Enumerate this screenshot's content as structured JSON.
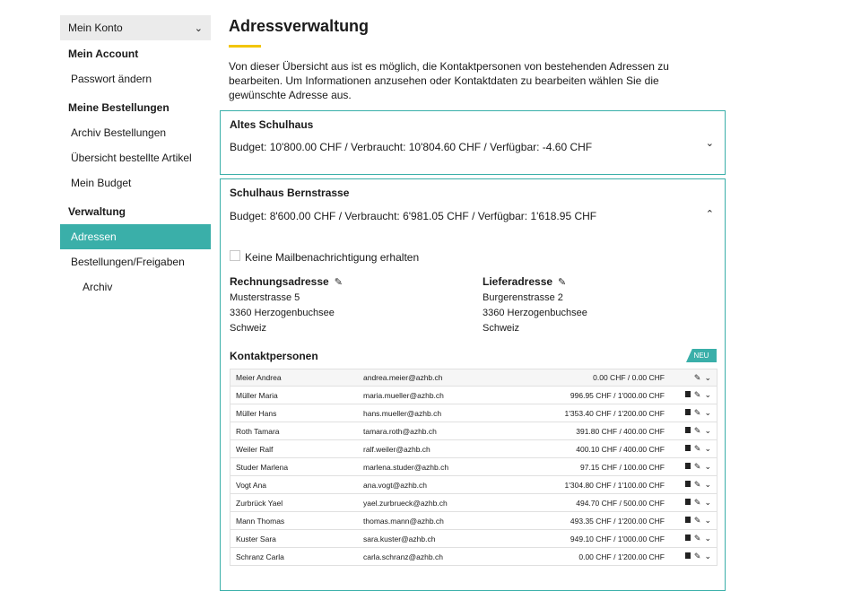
{
  "sidebar": {
    "header_label": "Mein Konto",
    "groups": [
      {
        "label": "Mein Account",
        "items": [
          {
            "label": "Passwort ändern"
          }
        ]
      },
      {
        "label": "Meine Bestellungen",
        "items": [
          {
            "label": "Archiv Bestellungen"
          },
          {
            "label": "Übersicht bestellte Artikel"
          },
          {
            "label": "Mein Budget"
          }
        ]
      },
      {
        "label": "Verwaltung",
        "items": [
          {
            "label": "Adressen"
          },
          {
            "label": "Bestellungen/Freigaben"
          },
          {
            "label": "Archiv"
          }
        ]
      }
    ]
  },
  "main": {
    "title": "Adressverwaltung",
    "intro": "Von dieser Übersicht aus ist es möglich, die Kontaktpersonen von bestehenden Adressen zu bearbeiten. Um Informationen anzusehen oder Kontaktdaten zu bearbeiten wählen Sie die gewünschte Adresse aus."
  },
  "cards": [
    {
      "title": "Altes Schulhaus",
      "budget": "Budget: 10'800.00 CHF / Verbraucht: 10'804.60 CHF / Verfügbar: -4.60 CHF"
    },
    {
      "title": "Schulhaus Bernstrasse",
      "budget": "Budget: 8'600.00 CHF / Verbraucht: 6'981.05 CHF / Verfügbar: 1'618.95 CHF"
    }
  ],
  "detail": {
    "checkbox_label": "Keine Mailbenachrichtigung erhalten",
    "rechnung": {
      "title": "Rechnungsadresse",
      "lines": [
        "Musterstrasse 5",
        "3360 Herzogenbuchsee",
        "Schweiz"
      ]
    },
    "liefer": {
      "title": "Lieferadresse",
      "lines": [
        "Burgerenstrasse 2",
        "3360 Herzogenbuchsee",
        "Schweiz"
      ]
    },
    "kontakt_title": "Kontaktpersonen",
    "neu_label": "NEU"
  },
  "contacts": [
    {
      "name": "Meier Andrea",
      "email": "andrea.meier@azhb.ch",
      "budget": "0.00 CHF / 0.00 CHF",
      "trash": false
    },
    {
      "name": "Müller Maria",
      "email": "maria.mueller@azhb.ch",
      "budget": "996.95 CHF / 1'000.00 CHF",
      "trash": true
    },
    {
      "name": "Müller Hans",
      "email": "hans.mueller@azhb.ch",
      "budget": "1'353.40 CHF / 1'200.00 CHF",
      "trash": true
    },
    {
      "name": "Roth Tamara",
      "email": "tamara.roth@azhb.ch",
      "budget": "391.80 CHF / 400.00 CHF",
      "trash": true
    },
    {
      "name": "Weiler Ralf",
      "email": "ralf.weiler@azhb.ch",
      "budget": "400.10 CHF / 400.00 CHF",
      "trash": true
    },
    {
      "name": "Studer Marlena",
      "email": "marlena.studer@azhb.ch",
      "budget": "97.15 CHF / 100.00 CHF",
      "trash": true
    },
    {
      "name": "Vogt Ana",
      "email": "ana.vogt@azhb.ch",
      "budget": "1'304.80 CHF / 1'100.00 CHF",
      "trash": true
    },
    {
      "name": "Zurbrück Yael",
      "email": "yael.zurbrueck@azhb.ch",
      "budget": "494.70 CHF / 500.00 CHF",
      "trash": true
    },
    {
      "name": "Mann Thomas",
      "email": "thomas.mann@azhb.ch",
      "budget": "493.35 CHF / 1'200.00 CHF",
      "trash": true
    },
    {
      "name": "Kuster Sara",
      "email": "sara.kuster@azhb.ch",
      "budget": "949.10 CHF / 1'000.00 CHF",
      "trash": true
    },
    {
      "name": "Schranz Carla",
      "email": "carla.schranz@azhb.ch",
      "budget": "0.00 CHF / 1'200.00 CHF",
      "trash": true
    }
  ],
  "colors": {
    "accent": "#3aafa9",
    "title_underline": "#f2c500",
    "sidebar_header_bg": "#ebebeb"
  }
}
